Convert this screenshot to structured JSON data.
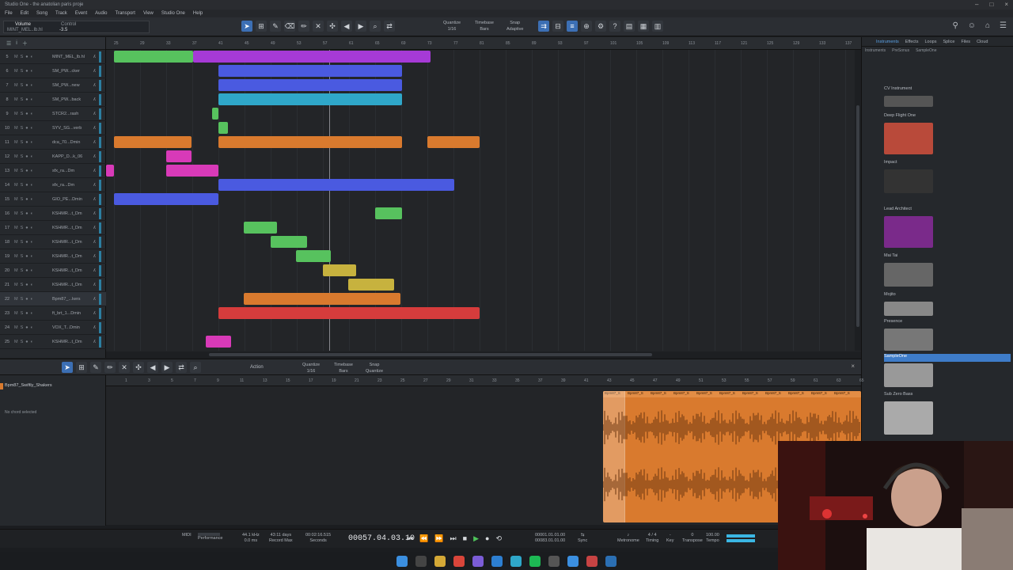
{
  "window": {
    "title": "Studio One - the anatolian paris proje"
  },
  "menu": [
    "File",
    "Edit",
    "Song",
    "Track",
    "Event",
    "Audio",
    "Transport",
    "View",
    "Studio One",
    "Help"
  ],
  "toolbar": {
    "param_label": "Volume",
    "param_value": "-3.5",
    "control_label": "Control",
    "track_label": "MINT_MEL..lb.hl",
    "quantize_label": "Quantize",
    "quantize_value": "1/16",
    "timebase_label": "Timebase",
    "timebase_value": "Bars",
    "snap_label": "Snap",
    "snap_value": "Adaptive"
  },
  "tracks": [
    {
      "n": "5",
      "name": "MINT_MEL_lb.hl"
    },
    {
      "n": "6",
      "name": "SM_PW...cker"
    },
    {
      "n": "7",
      "name": "SM_PW...new"
    },
    {
      "n": "8",
      "name": "SM_PW...back"
    },
    {
      "n": "9",
      "name": "STCR2...rash"
    },
    {
      "n": "10",
      "name": "SYV_SG...verb"
    },
    {
      "n": "11",
      "name": "dca_70...Dmin"
    },
    {
      "n": "12",
      "name": "KAPP_D...k_06"
    },
    {
      "n": "13",
      "name": "sfx_ra...Dm"
    },
    {
      "n": "14",
      "name": "sfx_ra...Dm"
    },
    {
      "n": "15",
      "name": "GIO_PE...Dmin"
    },
    {
      "n": "16",
      "name": "KSHMR...t_Dm"
    },
    {
      "n": "17",
      "name": "KSHMR...t_Dm"
    },
    {
      "n": "18",
      "name": "KSHMR...t_Dm"
    },
    {
      "n": "19",
      "name": "KSHMR...t_Dm"
    },
    {
      "n": "20",
      "name": "KSHMR...t_Dm"
    },
    {
      "n": "21",
      "name": "KSHMR...t_Dm"
    },
    {
      "n": "22",
      "name": "Bpm87_...kers"
    },
    {
      "n": "23",
      "name": "ft_brt_1...Dmin"
    },
    {
      "n": "24",
      "name": "VOX_T...Dmin"
    },
    {
      "n": "25",
      "name": "KSHMR...t_Dm"
    }
  ],
  "ruler_ticks": [
    "25",
    "29",
    "33",
    "37",
    "41",
    "45",
    "49",
    "53",
    "57",
    "61",
    "65",
    "69",
    "73",
    "77",
    "81",
    "85",
    "89",
    "93",
    "97",
    "101",
    "105",
    "109",
    "113",
    "117",
    "121",
    "125",
    "129",
    "133",
    "137"
  ],
  "browser": {
    "tabs": [
      "Instruments",
      "Effects",
      "Loops",
      "Splice",
      "Files",
      "Cloud"
    ],
    "sub": [
      "Instruments",
      "PreSonus",
      "SampleOne"
    ],
    "items": [
      {
        "label": "CV Instrument"
      },
      {
        "label": "Deep Flight One"
      },
      {
        "label": "Impact"
      },
      {
        "label": "Lead Architect"
      },
      {
        "label": "Mai Tai"
      },
      {
        "label": "Mojito"
      },
      {
        "label": "Presence"
      },
      {
        "label": "SampleOne"
      },
      {
        "label": "Sub Zero Bass"
      }
    ]
  },
  "editor": {
    "track_name": "Bpm87_Swiftly_Shakers",
    "no_chord": "No chord selected",
    "action_label": "Action",
    "quantize_value": "1/16",
    "timebase_value": "Bars",
    "snap_value": "Quantize",
    "event_label": "Bpm87_S",
    "ruler_ticks": [
      "1",
      "3",
      "5",
      "7",
      "9",
      "11",
      "13",
      "15",
      "17",
      "19",
      "21",
      "23",
      "25",
      "27",
      "29",
      "31",
      "33",
      "35",
      "37",
      "39",
      "41",
      "43",
      "45",
      "47",
      "49",
      "51",
      "53",
      "55",
      "57",
      "59",
      "61",
      "63",
      "65"
    ]
  },
  "transport": {
    "sample_rate": "44.1 kHz",
    "latency": "0.0 ms",
    "record_max": "43:11 days",
    "seconds": "00:02:16.515",
    "position": "00057.04.03.10",
    "loop_start": "00001.01.01.00",
    "loop_end": "00083.01.01.00",
    "signature": "4 / 4",
    "tempo": "100.00",
    "labels": {
      "performance": "Performance",
      "record": "Record Max",
      "seconds_l": "Seconds",
      "bars_l": "Bars",
      "sync": "Sync",
      "metronome": "Metronome",
      "timing": "Timing",
      "key": "Key",
      "transpose": "Transpose",
      "tempo_l": "Tempo"
    }
  },
  "colors": {
    "accent": "#3c6fb4",
    "purple": "#a63ad6",
    "blue": "#4a5ae0",
    "orange": "#d97a2e",
    "green": "#57c25e",
    "red": "#d63c3c",
    "cyan": "#2fa7c9",
    "pink": "#d83ab8",
    "yellow": "#c7b23e"
  }
}
